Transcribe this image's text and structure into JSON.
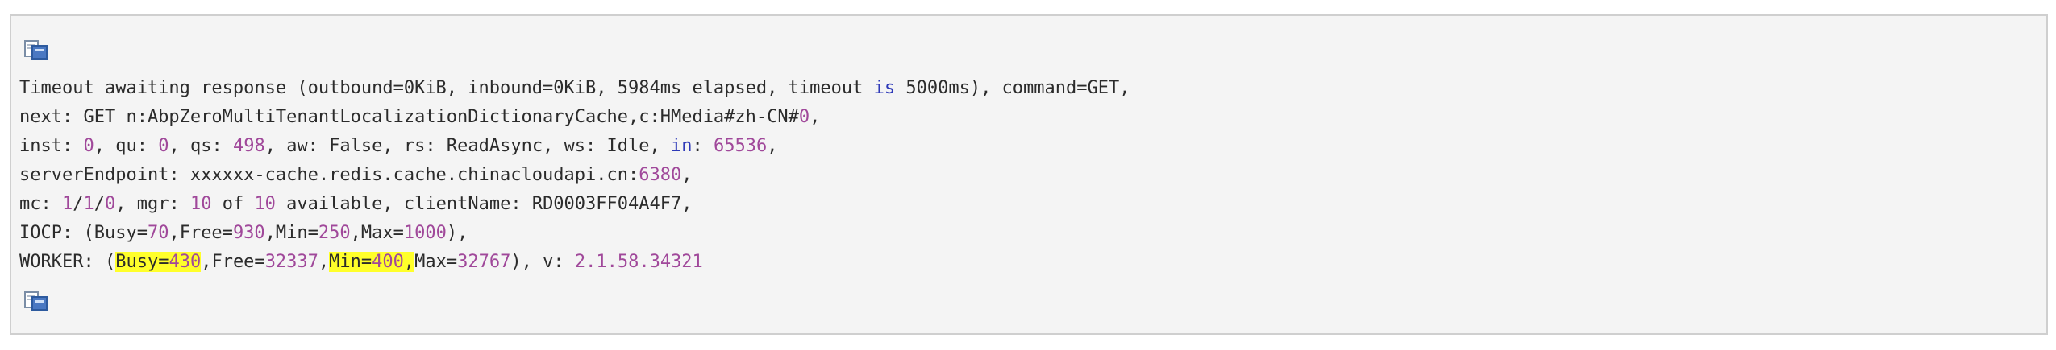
{
  "colors": {
    "background": "#f4f4f4",
    "border": "#cfcfcf",
    "text": "#2b2b2b",
    "number": "#a0489a",
    "keyword": "#2e39b8",
    "highlight": "#ffff2a"
  },
  "icons": {
    "top": "copy-icon",
    "bottom": "copy-icon"
  },
  "lines": [
    [
      {
        "t": "Timeout awaiting response (outbound=0KiB, inbound=0KiB, 5984ms elapsed, timeout ",
        "c": ""
      },
      {
        "t": "is",
        "c": "kw"
      },
      {
        "t": " 5000ms), command=GET,",
        "c": ""
      }
    ],
    [
      {
        "t": "next: GET n:AbpZeroMultiTenantLocalizationDictionaryCache,c:HMedia#zh-CN#",
        "c": ""
      },
      {
        "t": "0",
        "c": "num"
      },
      {
        "t": ",",
        "c": ""
      }
    ],
    [
      {
        "t": "inst: ",
        "c": ""
      },
      {
        "t": "0",
        "c": "num"
      },
      {
        "t": ", qu: ",
        "c": ""
      },
      {
        "t": "0",
        "c": "num"
      },
      {
        "t": ", qs: ",
        "c": ""
      },
      {
        "t": "498",
        "c": "num"
      },
      {
        "t": ", aw: False, rs: ReadAsync, ws: Idle, ",
        "c": ""
      },
      {
        "t": "in",
        "c": "kw"
      },
      {
        "t": ": ",
        "c": ""
      },
      {
        "t": "65536",
        "c": "num"
      },
      {
        "t": ",",
        "c": ""
      }
    ],
    [
      {
        "t": "serverEndpoint: xxxxxx-cache.redis.cache.chinacloudapi.cn:",
        "c": ""
      },
      {
        "t": "6380",
        "c": "num"
      },
      {
        "t": ",",
        "c": ""
      }
    ],
    [
      {
        "t": "mc: ",
        "c": ""
      },
      {
        "t": "1",
        "c": "num"
      },
      {
        "t": "/",
        "c": ""
      },
      {
        "t": "1",
        "c": "num"
      },
      {
        "t": "/",
        "c": ""
      },
      {
        "t": "0",
        "c": "num"
      },
      {
        "t": ", mgr: ",
        "c": ""
      },
      {
        "t": "10",
        "c": "num"
      },
      {
        "t": " of ",
        "c": ""
      },
      {
        "t": "10",
        "c": "num"
      },
      {
        "t": " available, clientName: RD0003FF04A4F7,",
        "c": ""
      }
    ],
    [
      {
        "t": "IOCP: (Busy=",
        "c": ""
      },
      {
        "t": "70",
        "c": "num"
      },
      {
        "t": ",Free=",
        "c": ""
      },
      {
        "t": "930",
        "c": "num"
      },
      {
        "t": ",Min=",
        "c": ""
      },
      {
        "t": "250",
        "c": "num"
      },
      {
        "t": ",Max=",
        "c": ""
      },
      {
        "t": "1000",
        "c": "num"
      },
      {
        "t": "),",
        "c": ""
      }
    ],
    [
      {
        "t": "WORKER: (",
        "c": ""
      },
      {
        "t": "Busy=",
        "c": "hl"
      },
      {
        "t": "430",
        "c": "hl num"
      },
      {
        "t": ",Free=",
        "c": ""
      },
      {
        "t": "32337",
        "c": "num"
      },
      {
        "t": ",",
        "c": ""
      },
      {
        "t": "Min=",
        "c": "hl"
      },
      {
        "t": "400",
        "c": "hl num"
      },
      {
        "t": ",",
        "c": "hl"
      },
      {
        "t": "Max=",
        "c": ""
      },
      {
        "t": "32767",
        "c": "num"
      },
      {
        "t": "), v: ",
        "c": ""
      },
      {
        "t": "2.1.58.34321",
        "c": "num"
      }
    ]
  ]
}
